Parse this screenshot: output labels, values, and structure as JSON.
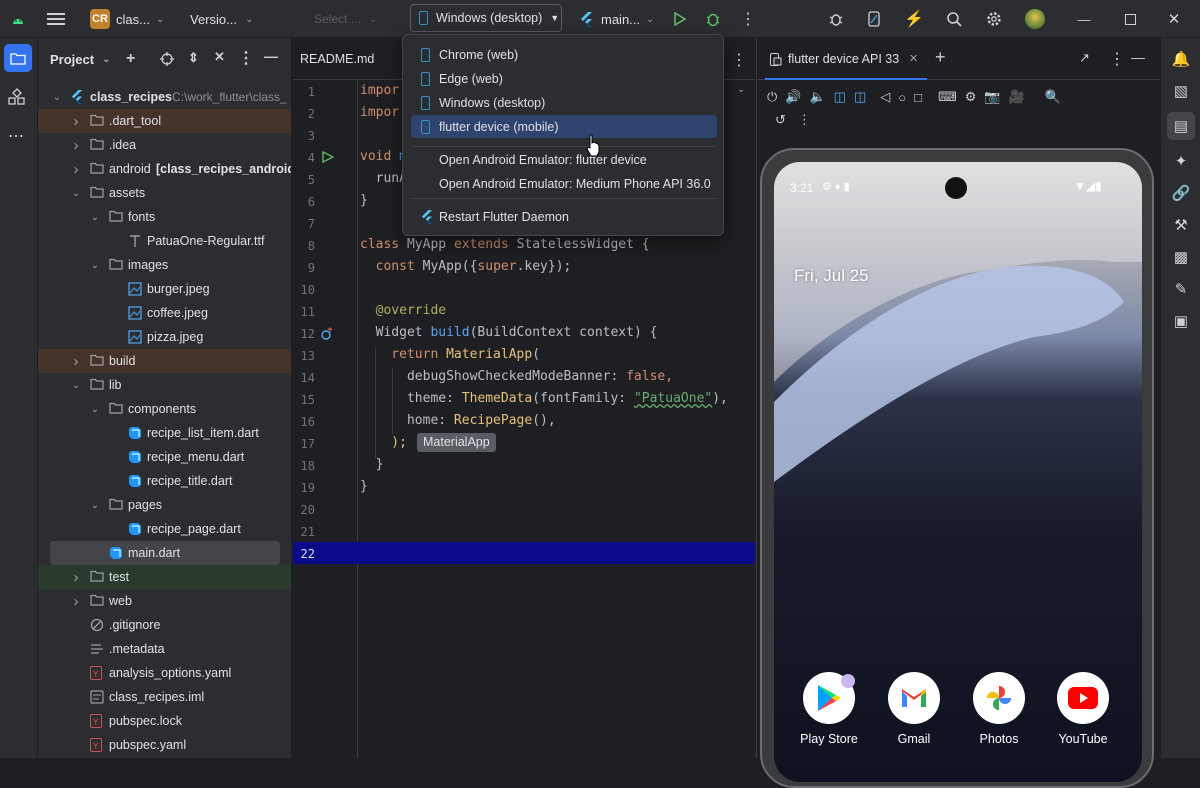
{
  "titlebar": {
    "project_badge": "CR",
    "project_name": "clas...",
    "vcs": "Versio...",
    "select_placeholder": "Select ...",
    "device_selector": "Windows (desktop)",
    "run_config": "main..."
  },
  "project_panel": {
    "title": "Project",
    "root_name": "class_recipes",
    "root_path": "C:\\work_flutter\\class_",
    "items": [
      {
        "label": ".dart_tool"
      },
      {
        "label": ".idea"
      },
      {
        "label": "android",
        "bold_suffix": "[class_recipes_android]"
      },
      {
        "label": "assets"
      },
      {
        "label": "fonts"
      },
      {
        "label": "PatuaOne-Regular.ttf"
      },
      {
        "label": "images"
      },
      {
        "label": "burger.jpeg"
      },
      {
        "label": "coffee.jpeg"
      },
      {
        "label": "pizza.jpeg"
      },
      {
        "label": "build"
      },
      {
        "label": "lib"
      },
      {
        "label": "components"
      },
      {
        "label": "recipe_list_item.dart"
      },
      {
        "label": "recipe_menu.dart"
      },
      {
        "label": "recipe_title.dart"
      },
      {
        "label": "pages"
      },
      {
        "label": "recipe_page.dart"
      },
      {
        "label": "main.dart"
      },
      {
        "label": "test"
      },
      {
        "label": "web"
      },
      {
        "label": ".gitignore"
      },
      {
        "label": ".metadata"
      },
      {
        "label": "analysis_options.yaml"
      },
      {
        "label": "class_recipes.iml"
      },
      {
        "label": "pubspec.lock"
      },
      {
        "label": "pubspec.yaml"
      }
    ]
  },
  "editor": {
    "tab": "README.md",
    "line_numbers": [
      "1",
      "2",
      "3",
      "4",
      "5",
      "6",
      "7",
      "8",
      "9",
      "10",
      "11",
      "12",
      "13",
      "14",
      "15",
      "16",
      "17",
      "18",
      "19",
      "20",
      "21",
      "22"
    ],
    "inline_hint": "MaterialApp",
    "code": {
      "l1": "impor",
      "l2": "impor",
      "l4a": "void ",
      "l4b": "m",
      "l5": "  runA",
      "l6": "}",
      "l8a": "class ",
      "l8b": "MyApp ",
      "l8c": "extends ",
      "l8d": "StatelessWidget {",
      "l9a": "  const ",
      "l9b": "MyApp({",
      "l9c": "super",
      "l9d": ".key});",
      "l11": "  @override",
      "l12a": "  Widget ",
      "l12b": "build",
      "l12c": "(BuildContext context) {",
      "l13a": "    return ",
      "l13b": "MaterialApp",
      "l13c": "(",
      "l14a": "      debugShowCheckedModeBanner: ",
      "l14b": "false",
      "l14c": ",",
      "l15a": "      theme: ",
      "l15b": "ThemeData",
      "l15c": "(fontFamily: ",
      "l15d": "\"PatuaOne\"",
      "l15e": "),",
      "l16a": "      home: ",
      "l16b": "RecipePage",
      "l16c": "(),",
      "l17": "    );",
      "l18": "  }",
      "l19": "}"
    }
  },
  "dropdown": {
    "items": [
      {
        "label": "Chrome (web)"
      },
      {
        "label": "Edge (web)"
      },
      {
        "label": "Windows (desktop)"
      },
      {
        "label": "flutter device (mobile)"
      }
    ],
    "emulators": [
      {
        "label": "Open Android Emulator: flutter device"
      },
      {
        "label": "Open Android Emulator: Medium Phone API 36.0"
      }
    ],
    "restart": "Restart Flutter Daemon"
  },
  "device_panel": {
    "tab": "flutter device API 33",
    "phone": {
      "time": "3:21",
      "date": "Fri, Jul 25",
      "apps": [
        {
          "label": "Play Store"
        },
        {
          "label": "Gmail"
        },
        {
          "label": "Photos"
        },
        {
          "label": "YouTube"
        }
      ]
    }
  },
  "colors": {
    "accent": "#3574f0",
    "selection": "#2e436e",
    "current_line": "#0a0a8a"
  }
}
